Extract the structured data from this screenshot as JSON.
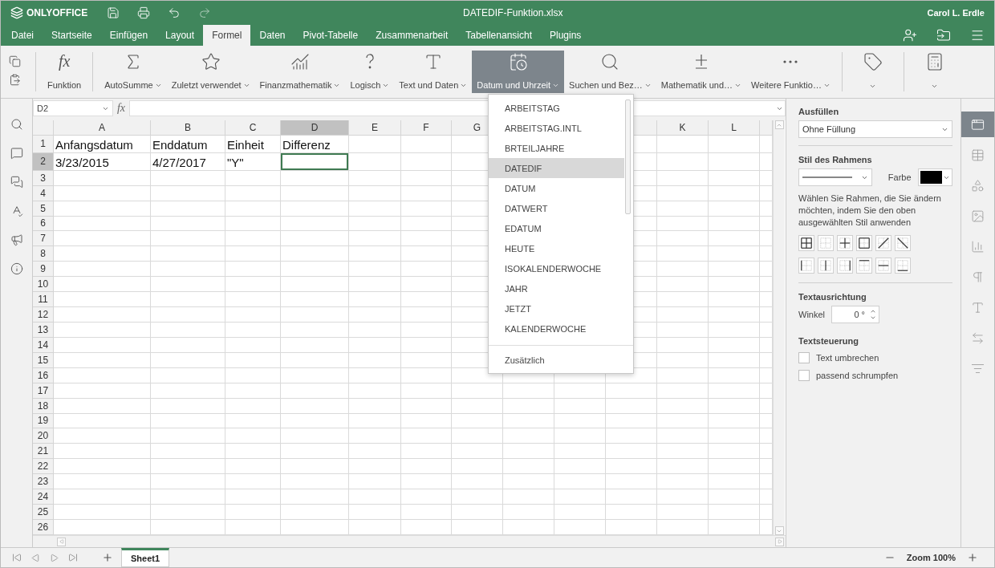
{
  "app": {
    "logo": "ONLYOFFICE",
    "title": "DATEDIF-Funktion.xlsx",
    "user": "Carol L. Erdle"
  },
  "tabs": [
    {
      "label": "Datei",
      "selected": false
    },
    {
      "label": "Startseite",
      "selected": false
    },
    {
      "label": "Einfügen",
      "selected": false
    },
    {
      "label": "Layout",
      "selected": false
    },
    {
      "label": "Formel",
      "selected": true
    },
    {
      "label": "Daten",
      "selected": false
    },
    {
      "label": "Pivot-Tabelle",
      "selected": false
    },
    {
      "label": "Zusammenarbeit",
      "selected": false
    },
    {
      "label": "Tabellenansicht",
      "selected": false
    },
    {
      "label": "Plugins",
      "selected": false
    }
  ],
  "toolbar": {
    "function_button": {
      "symbol": "fx",
      "label": "Funktion"
    },
    "buttons": [
      {
        "kind": "sum",
        "label": "AutoSumme",
        "selected": false
      },
      {
        "kind": "star",
        "label": "Zuletzt verwendet",
        "selected": false
      },
      {
        "kind": "finance",
        "label": "Finanzmathematik",
        "selected": false
      },
      {
        "kind": "logic",
        "label": "Logisch",
        "selected": false
      },
      {
        "kind": "text",
        "label": "Text und Daten",
        "selected": false
      },
      {
        "kind": "date",
        "label": "Datum und Uhrzeit",
        "selected": true
      },
      {
        "kind": "lookup",
        "label": "Suchen und Bez…",
        "selected": false
      },
      {
        "kind": "math",
        "label": "Mathematik und…",
        "selected": false
      },
      {
        "kind": "more",
        "label": "Weitere Funktio…",
        "selected": false
      },
      {
        "kind": "tag",
        "selected": false
      },
      {
        "kind": "calc",
        "selected": false
      }
    ]
  },
  "formula_bar": {
    "name_box": "D2",
    "symbol": "fx"
  },
  "sheet": {
    "columns": [
      {
        "label": "A",
        "selected": false
      },
      {
        "label": "B",
        "selected": false
      },
      {
        "label": "C",
        "selected": false
      },
      {
        "label": "D",
        "selected": true
      },
      {
        "label": "E",
        "selected": false
      },
      {
        "label": "F",
        "selected": false
      },
      {
        "label": "G",
        "selected": false
      },
      {},
      {},
      {},
      {
        "label": "K",
        "selected": false
      },
      {
        "label": "L",
        "selected": false
      },
      {}
    ],
    "rows": [
      {
        "number": "1",
        "selected": false,
        "cells": [
          "Anfangsdatum",
          "Enddatum",
          "Einheit",
          "Differenz"
        ]
      },
      {
        "number": "2",
        "selected": true,
        "cells": [
          "3/23/2015",
          "4/27/2017",
          "\"Y\""
        ]
      },
      {
        "number": "3",
        "selected": false
      },
      {
        "number": "4",
        "selected": false
      },
      {
        "number": "5",
        "selected": false
      },
      {
        "number": "6",
        "selected": false
      },
      {
        "number": "7",
        "selected": false
      },
      {
        "number": "8",
        "selected": false
      },
      {
        "number": "9",
        "selected": false
      },
      {
        "number": "10",
        "selected": false
      },
      {
        "number": "11",
        "selected": false
      },
      {
        "number": "12",
        "selected": false
      },
      {
        "number": "13",
        "selected": false
      },
      {
        "number": "14",
        "selected": false
      },
      {
        "number": "15",
        "selected": false
      },
      {
        "number": "16",
        "selected": false
      },
      {
        "number": "17",
        "selected": false
      },
      {
        "number": "18",
        "selected": false
      },
      {
        "number": "19",
        "selected": false
      },
      {
        "number": "20",
        "selected": false
      },
      {
        "number": "21",
        "selected": false
      },
      {
        "number": "22",
        "selected": false
      },
      {
        "number": "23",
        "selected": false
      },
      {
        "number": "24",
        "selected": false
      },
      {
        "number": "25",
        "selected": false
      },
      {
        "number": "26",
        "selected": false
      }
    ]
  },
  "menu": {
    "items": [
      {
        "label": "ARBEITSTAG",
        "selected": false
      },
      {
        "label": "ARBEITSTAG.INTL",
        "selected": false
      },
      {
        "label": "BRTEILJAHRE",
        "selected": false
      },
      {
        "label": "DATEDIF",
        "selected": true
      },
      {
        "label": "DATUM",
        "selected": false
      },
      {
        "label": "DATWERT",
        "selected": false
      },
      {
        "label": "EDATUM",
        "selected": false
      },
      {
        "label": "HEUTE",
        "selected": false
      },
      {
        "label": "ISOKALENDERWOCHE",
        "selected": false
      },
      {
        "label": "JAHR",
        "selected": false
      },
      {
        "label": "JETZT",
        "selected": false
      },
      {
        "label": "KALENDERWOCHE",
        "selected": false
      }
    ],
    "footer": "Zusätzlich"
  },
  "panel": {
    "fill_title": "Ausfüllen",
    "fill_value": "Ohne Füllung",
    "border_title": "Stil des Rahmens",
    "color_label": "Farbe",
    "hint": "Wählen Sie Rahmen, die Sie ändern möchten, indem Sie den oben ausgewählten Stil anwenden",
    "orientation_title": "Textausrichtung",
    "angle_label": "Winkel",
    "angle_value": "0 °",
    "control_title": "Textsteuerung",
    "checkboxes": [
      {
        "label": "Text umbrechen",
        "checked": false
      },
      {
        "label": "passend schrumpfen",
        "checked": false
      }
    ]
  },
  "right_icons": [
    {
      "kind": "cell",
      "selected": true
    },
    {
      "kind": "table",
      "selected": false
    },
    {
      "kind": "shape",
      "selected": false
    },
    {
      "kind": "image",
      "selected": false
    },
    {
      "kind": "chart",
      "selected": false
    },
    {
      "kind": "paragraph",
      "selected": false
    },
    {
      "kind": "textart",
      "selected": false
    },
    {
      "kind": "pivot",
      "selected": false
    },
    {
      "kind": "filter",
      "selected": false
    }
  ],
  "sheet_tabs": [
    {
      "label": "Sheet1",
      "selected": true
    }
  ],
  "zoom": "Zoom 100%"
}
